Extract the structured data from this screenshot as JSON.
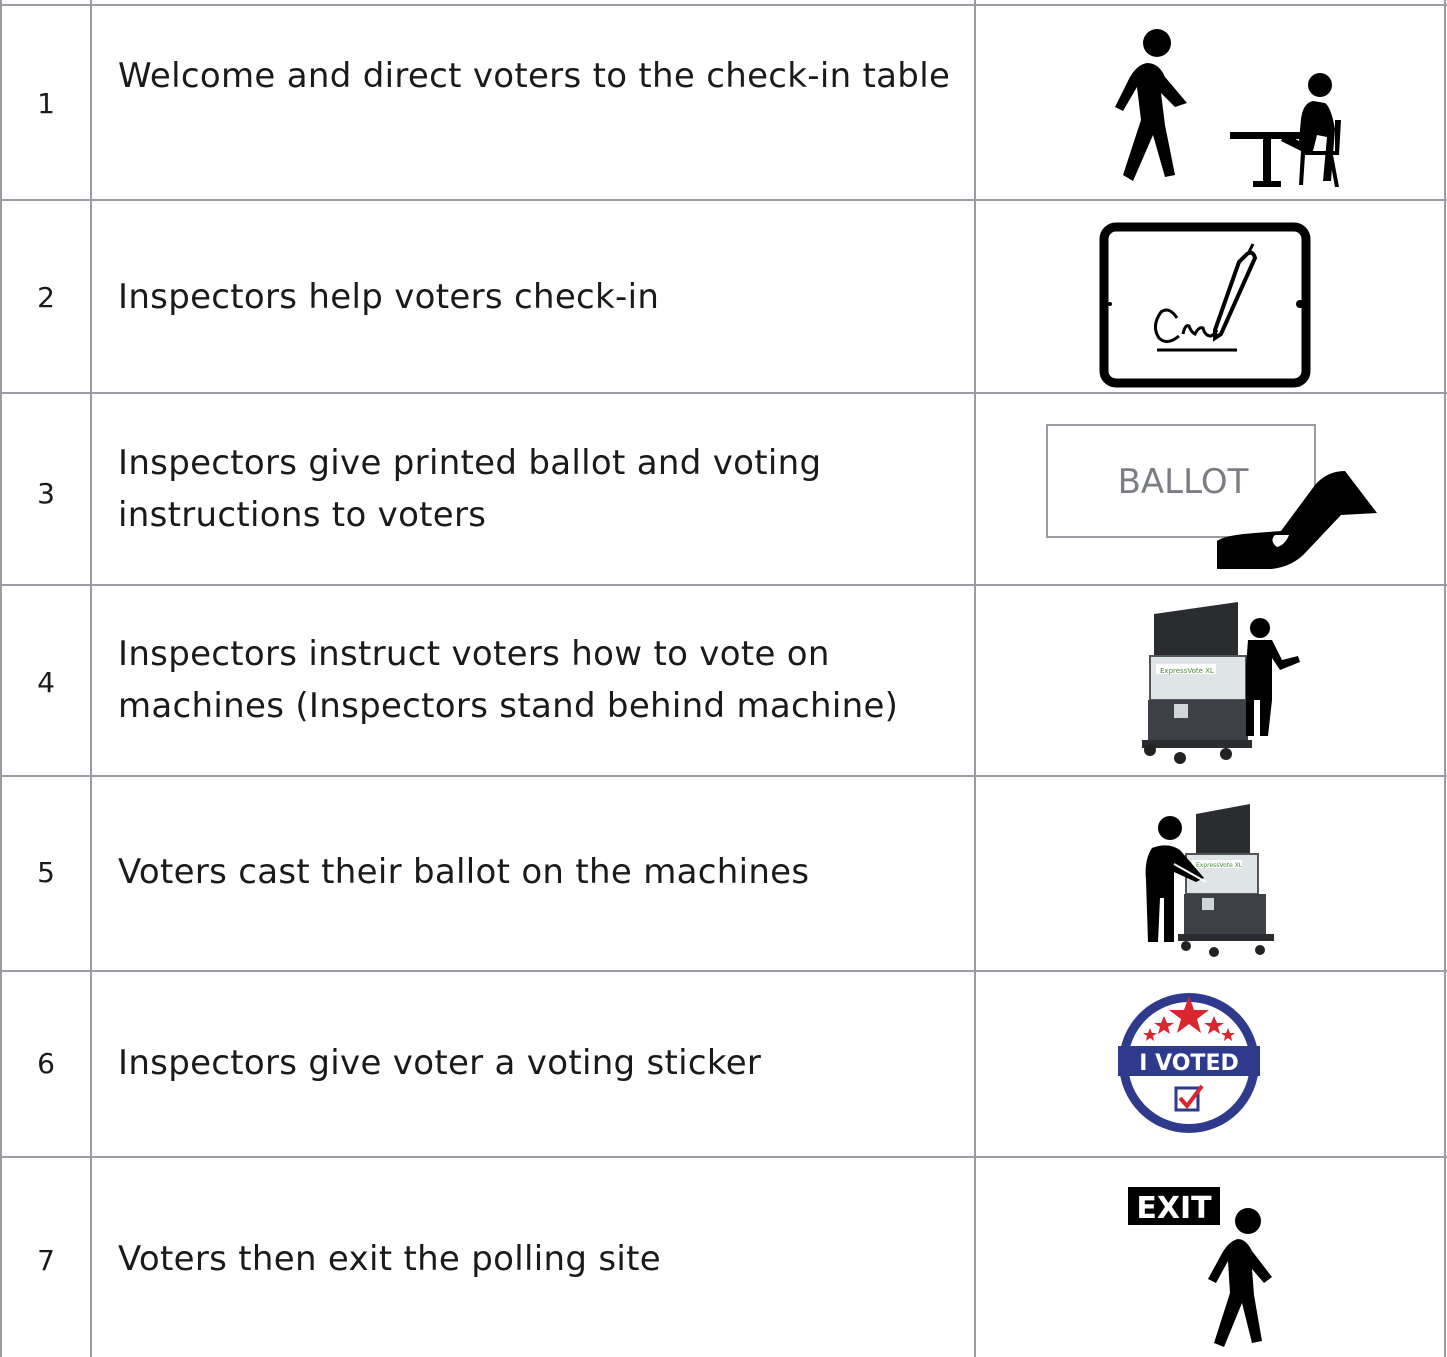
{
  "rows": [
    {
      "number": "1",
      "text": "Welcome and direct voters to the check-in table",
      "icon": "walking-person-to-check-in-desk-icon"
    },
    {
      "number": "2",
      "text": "Inspectors help voters check-in",
      "icon": "tablet-signature-icon"
    },
    {
      "number": "3",
      "text": "Inspectors give printed ballot and voting instructions to voters",
      "icon": "hand-giving-ballot-icon",
      "icon_label": "BALLOT"
    },
    {
      "number": "4",
      "text": "Inspectors instruct voters how to vote on machines (Inspectors stand behind machine)",
      "icon": "inspector-behind-voting-machine-icon"
    },
    {
      "number": "5",
      "text": "Voters cast their ballot on the machines",
      "icon": "voter-at-voting-machine-icon"
    },
    {
      "number": "6",
      "text": "Inspectors give voter a voting sticker",
      "icon": "i-voted-sticker-icon",
      "icon_label": "I VOTED"
    },
    {
      "number": "7",
      "text": "Voters then exit the polling site",
      "icon": "exit-sign-person-walking-icon",
      "icon_label": "EXIT"
    }
  ],
  "colors": {
    "grid": "#9a9ca3",
    "sticker_blue": "#2e3a8c",
    "sticker_red": "#d9262f",
    "icon": "#000000"
  }
}
